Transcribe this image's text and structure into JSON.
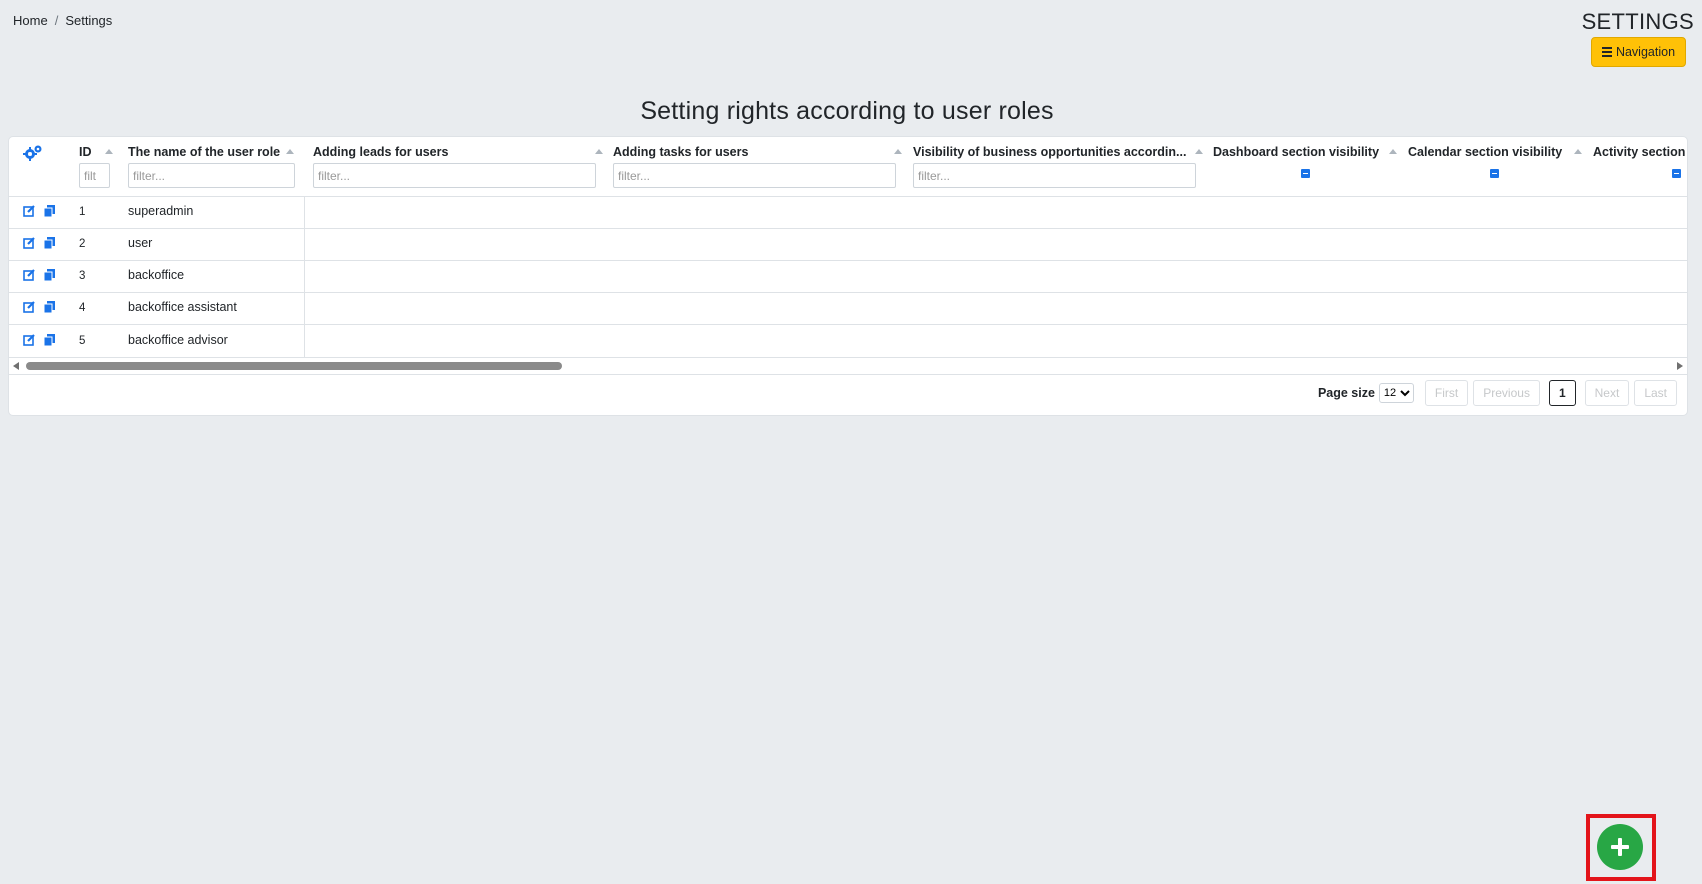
{
  "breadcrumb": {
    "home": "Home",
    "separator": "/",
    "current": "Settings"
  },
  "header": {
    "title": "SETTINGS",
    "nav_button": "Navigation"
  },
  "page_title": "Setting rights according to user roles",
  "table": {
    "columns": {
      "id": {
        "label": "ID",
        "filter_placeholder": "filt"
      },
      "role_name": {
        "label": "The name of the user role",
        "filter_placeholder": "filter..."
      },
      "adding_leads": {
        "label": "Adding leads for users",
        "filter_placeholder": "filter..."
      },
      "adding_tasks": {
        "label": "Adding tasks for users",
        "filter_placeholder": "filter..."
      },
      "opportunities": {
        "label": "Visibility of business opportunities accordin...",
        "filter_placeholder": "filter..."
      },
      "dashboard": {
        "label": "Dashboard section visibility"
      },
      "calendar": {
        "label": "Calendar section visibility"
      },
      "activity": {
        "label": "Activity section v"
      }
    },
    "rows": [
      {
        "id": "1",
        "name": "superadmin"
      },
      {
        "id": "2",
        "name": "user"
      },
      {
        "id": "3",
        "name": "backoffice"
      },
      {
        "id": "4",
        "name": "backoffice assistant"
      },
      {
        "id": "5",
        "name": "backoffice advisor"
      }
    ]
  },
  "pagination": {
    "page_size_label": "Page size",
    "page_size_value": "12",
    "first": "First",
    "previous": "Previous",
    "current_page": "1",
    "next": "Next",
    "last": "Last"
  },
  "colors": {
    "accent": "#1a73e8",
    "warning": "#ffc107",
    "success": "#28a745",
    "highlight": "#e3141a"
  }
}
